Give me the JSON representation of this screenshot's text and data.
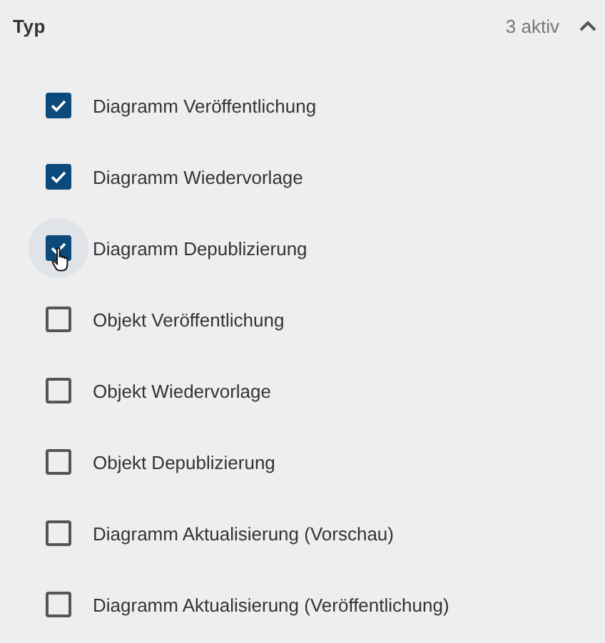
{
  "section": {
    "title": "Typ",
    "count": "3 aktiv",
    "expanded": true
  },
  "options": [
    {
      "label": "Diagramm Veröffentlichung",
      "checked": true,
      "hovered": false
    },
    {
      "label": "Diagramm Wiedervorlage",
      "checked": true,
      "hovered": false
    },
    {
      "label": "Diagramm Depublizierung",
      "checked": true,
      "hovered": true
    },
    {
      "label": "Objekt Veröffentlichung",
      "checked": false,
      "hovered": false
    },
    {
      "label": "Objekt Wiedervorlage",
      "checked": false,
      "hovered": false
    },
    {
      "label": "Objekt Depublizierung",
      "checked": false,
      "hovered": false
    },
    {
      "label": "Diagramm Aktualisierung (Vorschau)",
      "checked": false,
      "hovered": false
    },
    {
      "label": "Diagramm Aktualisierung (Veröffentlichung)",
      "checked": false,
      "hovered": false
    }
  ]
}
